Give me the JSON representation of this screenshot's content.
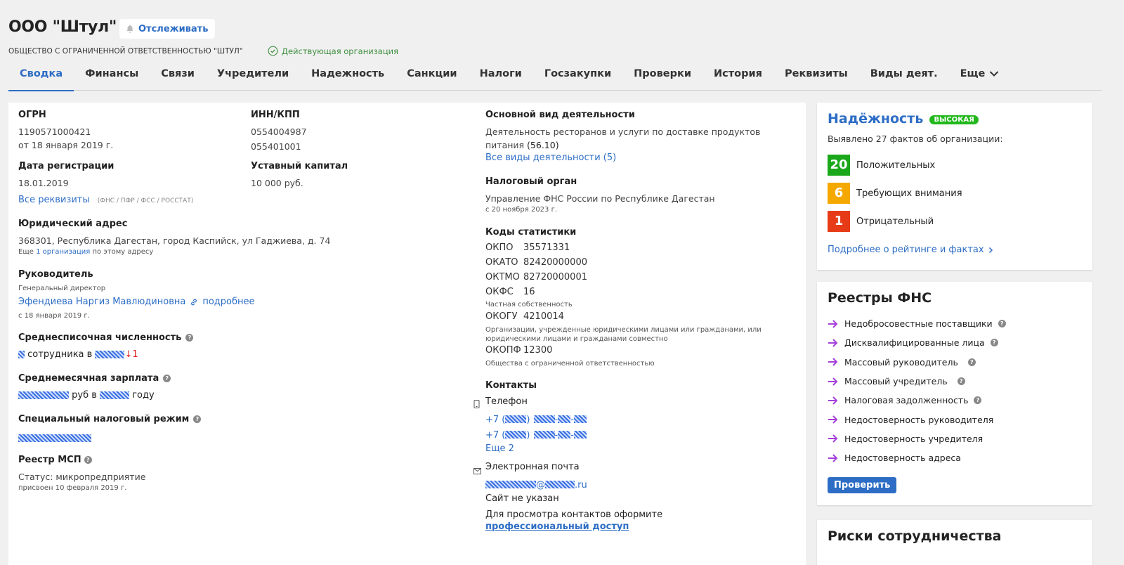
{
  "header": {
    "title": "ООО \"Штул\"",
    "track_label": "Отслеживать",
    "full_name": "ОБЩЕСТВО С ОГРАНИЧЕННОЙ ОТВЕТСТВЕННОСТЬЮ \"ШТУЛ\"",
    "status": "Действующая организация"
  },
  "tabs": [
    "Сводка",
    "Финансы",
    "Связи",
    "Учредители",
    "Надежность",
    "Санкции",
    "Налоги",
    "Госзакупки",
    "Проверки",
    "История",
    "Реквизиты",
    "Виды деят."
  ],
  "tab_more": "Еще",
  "left": {
    "ogrn_label": "ОГРН",
    "ogrn": "1190571000421",
    "ogrn_date": "от 18 января 2019 г.",
    "inn_label": "ИНН/КПП",
    "inn": "0554004987",
    "kpp": "055401001",
    "reg_label": "Дата регистрации",
    "reg_date": "18.01.2019",
    "capital_label": "Уставный капитал",
    "capital": "10 000 руб.",
    "all_req": "Все реквизиты",
    "all_req_note": "(ФНС / ПФР / ФСС / РОССТАТ)",
    "address_label": "Юридический адрес",
    "address": "368301, Республика Дагестан, город Каспийск, ул Гаджиева, д. 74",
    "address_more_pre": "Еще",
    "address_more_link": "1 организация",
    "address_more_post": "по этому адресу",
    "head_label": "Руководитель",
    "head_role": "Генеральный директор",
    "head_name": "Эфендиева Наргиз Мавлюдиновна",
    "head_more": "подробнее",
    "head_since": "с 18 января 2019 г.",
    "staff_label": "Среднесписочная численность",
    "staff_text": "сотрудника в",
    "staff_delta": "↓1",
    "salary_label": "Среднемесячная зарплата",
    "salary_mid": "руб в",
    "salary_end": "году",
    "tax_label": "Специальный налоговый режим",
    "msp_label": "Реестр МСП",
    "msp_status": "Статус: микропредприятие",
    "msp_date": "присвоен 10 февраля 2019 г."
  },
  "right": {
    "activity_label": "Основной вид деятельности",
    "activity_text": "Деятельность ресторанов и услуги по доставке продуктов питания",
    "activity_code": "(56.10)",
    "activity_all": "Все виды деятельности (5)",
    "tax_org_label": "Налоговый орган",
    "tax_org": "Управление ФНС России по Республике Дагестан",
    "tax_org_date": "с 20 ноября 2023 г.",
    "codes_label": "Коды статистики",
    "codes": [
      {
        "k": "ОКПО",
        "v": "35571331"
      },
      {
        "k": "ОКАТО",
        "v": "82420000000"
      },
      {
        "k": "ОКТМО",
        "v": "82720000001"
      },
      {
        "k": "ОКФС",
        "v": "16"
      }
    ],
    "okfs_note": "Частная собственность",
    "okogu_k": "ОКОГУ",
    "okogu_v": "4210014",
    "okogu_note": "Организации, учрежденные юридическими лицами или гражданами, или юридическими лицами и гражданами совместно",
    "okopf_k": "ОКОПФ",
    "okopf_v": "12300",
    "okopf_note": "Общества с ограниченной ответственностью",
    "contacts_label": "Контакты",
    "phone_label": "Телефон",
    "phone_prefix": "+7 (",
    "phone_more": "Еще 2",
    "email_label": "Электронная почта",
    "email_tail": ".ru",
    "site": "Сайт не указан",
    "pro_text": "Для просмотра контактов оформите",
    "pro_link": "профессиональный доступ"
  },
  "rating": {
    "title": "Надёжность",
    "badge": "ВЫСОКАЯ",
    "subtitle": "Выявлено 27 фактов об организации:",
    "facts": [
      {
        "num": "20",
        "text": "Положительных",
        "color": "#1aa81a"
      },
      {
        "num": "6",
        "text": "Требующих внимания",
        "color": "#f5a800"
      },
      {
        "num": "1",
        "text": "Отрицательный",
        "color": "#e63b16"
      }
    ],
    "more": "Подробнее о рейтинге и фактах"
  },
  "fns": {
    "title": "Реестры ФНС",
    "items": [
      {
        "text": "Недобросовестные поставщики",
        "q": true
      },
      {
        "text": "Дисквалифицированные лица",
        "q": true
      },
      {
        "text": "Массовый руководитель",
        "q": true
      },
      {
        "text": "Массовый учредитель",
        "q": true
      },
      {
        "text": "Налоговая задолженность",
        "q": true
      },
      {
        "text": "Недостоверность руководителя",
        "q": false
      },
      {
        "text": "Недостоверность учредителя",
        "q": false
      },
      {
        "text": "Недостоверность адреса",
        "q": false
      }
    ],
    "check": "Проверить"
  },
  "risks": {
    "title": "Риски сотрудничества"
  },
  "colors": {
    "accent": "#2d6dc5",
    "arrow": "#a43fd8"
  }
}
